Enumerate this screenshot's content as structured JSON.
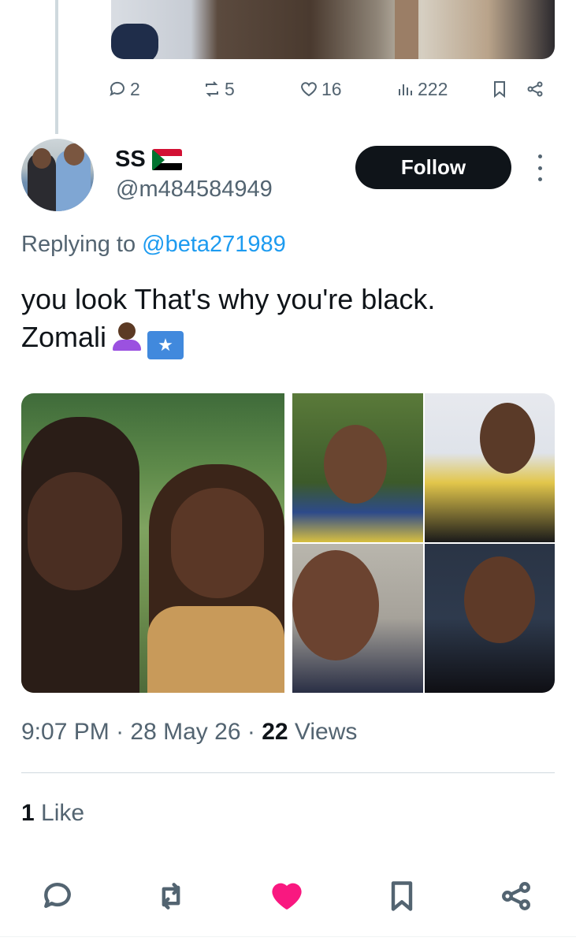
{
  "previous_tweet": {
    "replies": "2",
    "reposts": "5",
    "likes": "16",
    "views": "222"
  },
  "author": {
    "display_name": "SS",
    "flag_icon": "sudan-flag-icon",
    "handle": "@m484584949"
  },
  "follow_label": "Follow",
  "replying": {
    "prefix": "Replying to",
    "handle": "@beta271989"
  },
  "tweet": {
    "line1": "you look  That's why you're black.",
    "line2": "Zomali",
    "emojis": [
      "person-dark-skin-tone-emoji",
      "somalia-flag-emoji"
    ]
  },
  "meta": {
    "time": "9:07 PM",
    "separator": "·",
    "date": "28 May 26",
    "views_count": "22",
    "views_label": "Views"
  },
  "likes": {
    "count": "1",
    "label": "Like"
  },
  "colors": {
    "accent": "#1d9bf0",
    "like": "#f91880",
    "secondary_text": "#536471",
    "primary_text": "#0f1419"
  }
}
